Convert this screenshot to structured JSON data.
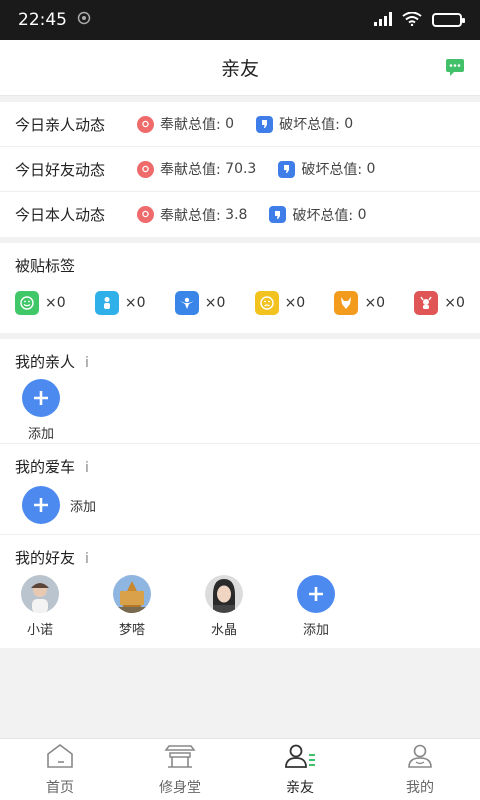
{
  "status": {
    "time": "22:45"
  },
  "header": {
    "title": "亲友"
  },
  "dynamics": [
    {
      "label": "今日亲人动态",
      "contrib_label": "奉献总值:",
      "contrib": "0",
      "damage_label": "破坏总值:",
      "damage": "0"
    },
    {
      "label": "今日好友动态",
      "contrib_label": "奉献总值:",
      "contrib": "70.3",
      "damage_label": "破坏总值:",
      "damage": "0"
    },
    {
      "label": "今日本人动态",
      "contrib_label": "奉献总值:",
      "contrib": "3.8",
      "damage_label": "破坏总值:",
      "damage": "0"
    }
  ],
  "tags_section": {
    "title": "被贴标签",
    "tags": [
      {
        "icon": "smile-icon",
        "color": "#3fc768",
        "count": "×0"
      },
      {
        "icon": "baby-icon",
        "color": "#2fb0e8",
        "count": "×0"
      },
      {
        "icon": "angel-icon",
        "color": "#3a86e8",
        "count": "×0"
      },
      {
        "icon": "sad-face-icon",
        "color": "#f2c21f",
        "count": "×0"
      },
      {
        "icon": "fox-icon",
        "color": "#f29b1c",
        "count": "×0"
      },
      {
        "icon": "devil-icon",
        "color": "#e05555",
        "count": "×0"
      }
    ]
  },
  "relatives": {
    "title": "我的亲人",
    "info": "i",
    "add_label": "添加"
  },
  "car": {
    "title": "我的爱车",
    "info": "i",
    "add_label": "添加"
  },
  "friends": {
    "title": "我的好友",
    "info": "i",
    "list": [
      {
        "name": "小诺"
      },
      {
        "name": "梦嗒"
      },
      {
        "name": "水晶"
      }
    ],
    "add_label": "添加"
  },
  "tabbar": {
    "tabs": [
      {
        "label": "首页",
        "icon": "home-icon"
      },
      {
        "label": "修身堂",
        "icon": "temple-icon"
      },
      {
        "label": "亲友",
        "icon": "friends-icon"
      },
      {
        "label": "我的",
        "icon": "profile-icon"
      }
    ],
    "active_index": 2
  },
  "colors": {
    "accent": "#4c8af0",
    "red_icon": "#ef6b6b",
    "blue_icon": "#3f7ee8"
  }
}
